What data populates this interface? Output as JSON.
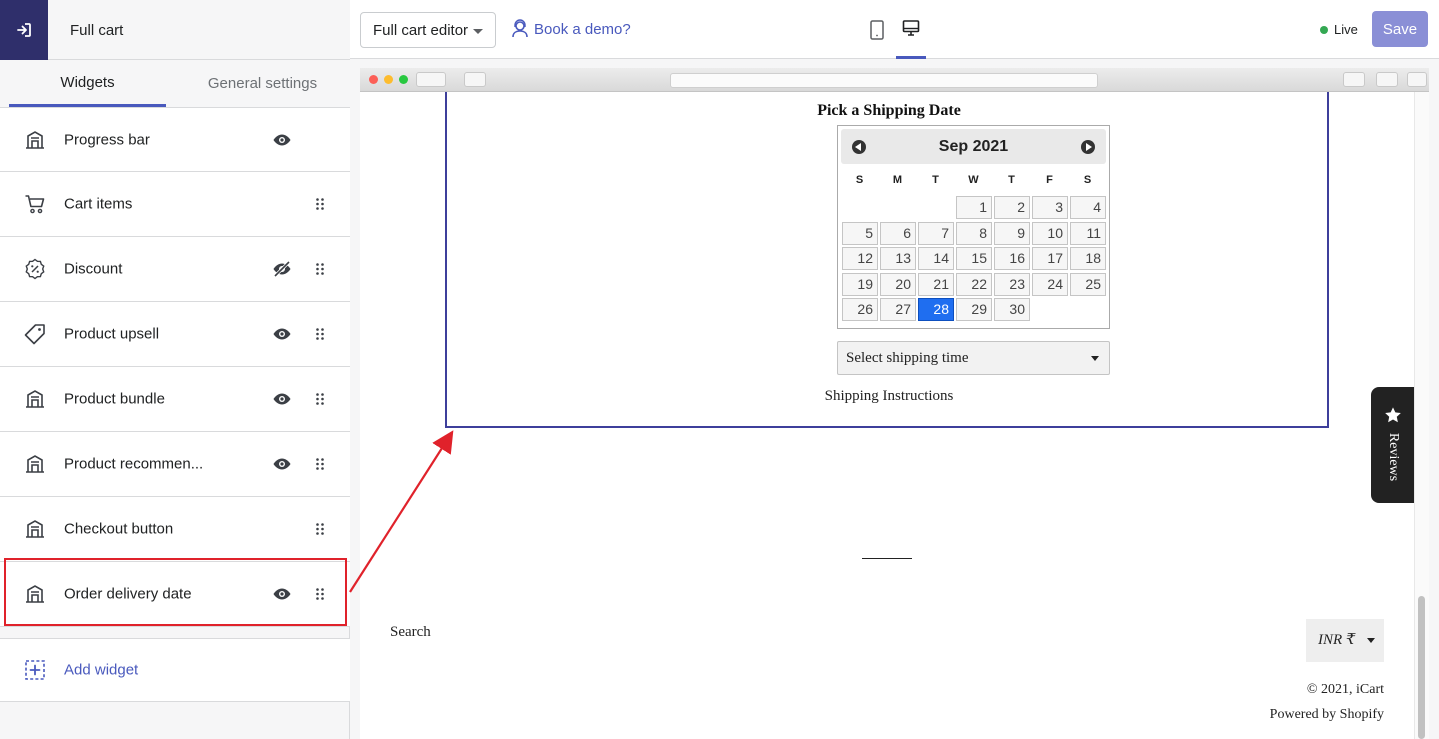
{
  "sidebar": {
    "title": "Full cart",
    "tabs": [
      {
        "label": "Widgets",
        "active": true
      },
      {
        "label": "General settings",
        "active": false
      }
    ],
    "widgets": [
      {
        "label": "Progress bar",
        "icon": "widget-block-icon",
        "visible": true,
        "draggable": false
      },
      {
        "label": "Cart items",
        "icon": "cart-icon",
        "visible": null,
        "draggable": true
      },
      {
        "label": "Discount",
        "icon": "discount-icon",
        "visible": false,
        "draggable": true
      },
      {
        "label": "Product upsell",
        "icon": "tag-icon",
        "visible": true,
        "draggable": true
      },
      {
        "label": "Product bundle",
        "icon": "widget-block-icon",
        "visible": true,
        "draggable": true
      },
      {
        "label": "Product recommen...",
        "icon": "widget-block-icon",
        "visible": true,
        "draggable": true
      },
      {
        "label": "Checkout button",
        "icon": "widget-block-icon",
        "visible": null,
        "draggable": true
      },
      {
        "label": "Order delivery date",
        "icon": "widget-block-icon",
        "visible": true,
        "draggable": true,
        "highlighted": true
      }
    ],
    "add_widget_label": "Add widget"
  },
  "topbar": {
    "editor_select": "Full cart editor",
    "demo_link": "Book a demo?",
    "status": "Live",
    "save_label": "Save",
    "active_device": "desktop"
  },
  "preview": {
    "shipping_title": "Pick a Shipping Date",
    "calendar": {
      "month": "Sep 2021",
      "weekdays": [
        "S",
        "M",
        "T",
        "W",
        "T",
        "F",
        "S"
      ],
      "first_weekday_index": 3,
      "days_in_month": 30,
      "selected_day": 28
    },
    "shipping_time_placeholder": "Select shipping time",
    "shipping_instructions": "Shipping Instructions",
    "footer": {
      "search_link": "Search",
      "currency": "INR ₹",
      "copyright": "© 2021, iCart",
      "powered_by": "Powered by Shopify"
    },
    "reviews_tab": "Reviews"
  },
  "colors": {
    "accent": "#4959bd",
    "sidebar_dark": "#2f2f6b",
    "highlight_red": "#e0222b",
    "selected_day": "#1f6ef0",
    "live_green": "#34a853"
  }
}
